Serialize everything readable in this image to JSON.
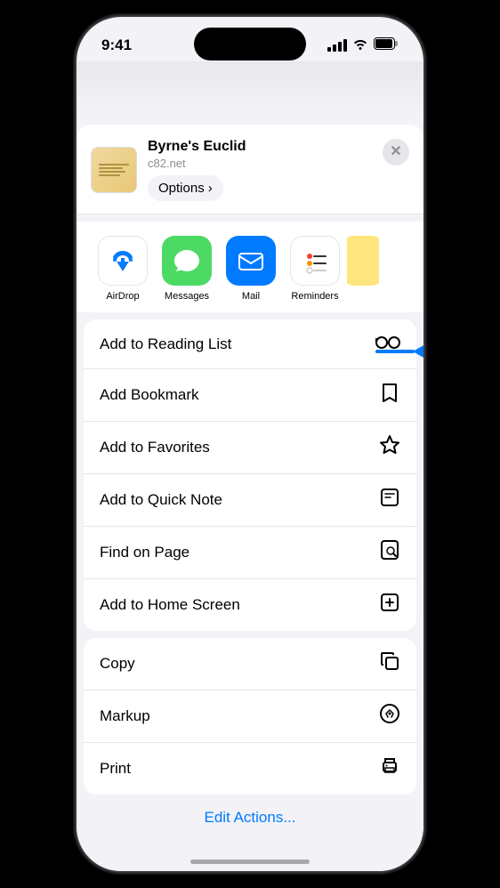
{
  "statusBar": {
    "time": "9:41",
    "signalBars": 4,
    "wifiOn": true,
    "batteryFull": true
  },
  "shareHeader": {
    "title": "Byrne's Euclid",
    "url": "c82.net",
    "optionsLabel": "Options",
    "optionsChevron": "›",
    "closeLabel": "×"
  },
  "apps": [
    {
      "name": "AirDrop",
      "type": "airdrop"
    },
    {
      "name": "Messages",
      "type": "messages"
    },
    {
      "name": "Mail",
      "type": "mail"
    },
    {
      "name": "Reminders",
      "type": "reminders"
    }
  ],
  "actionGroup1": [
    {
      "label": "Add to Reading List",
      "icon": "glasses",
      "highlighted": true
    },
    {
      "label": "Add Bookmark",
      "icon": "book"
    },
    {
      "label": "Add to Favorites",
      "icon": "star"
    },
    {
      "label": "Add to Quick Note",
      "icon": "note"
    },
    {
      "label": "Find on Page",
      "icon": "find"
    },
    {
      "label": "Add to Home Screen",
      "icon": "plus-square"
    }
  ],
  "actionGroup2": [
    {
      "label": "Copy",
      "icon": "copy"
    },
    {
      "label": "Markup",
      "icon": "markup"
    },
    {
      "label": "Print",
      "icon": "print"
    }
  ],
  "editActionsLabel": "Edit Actions..."
}
